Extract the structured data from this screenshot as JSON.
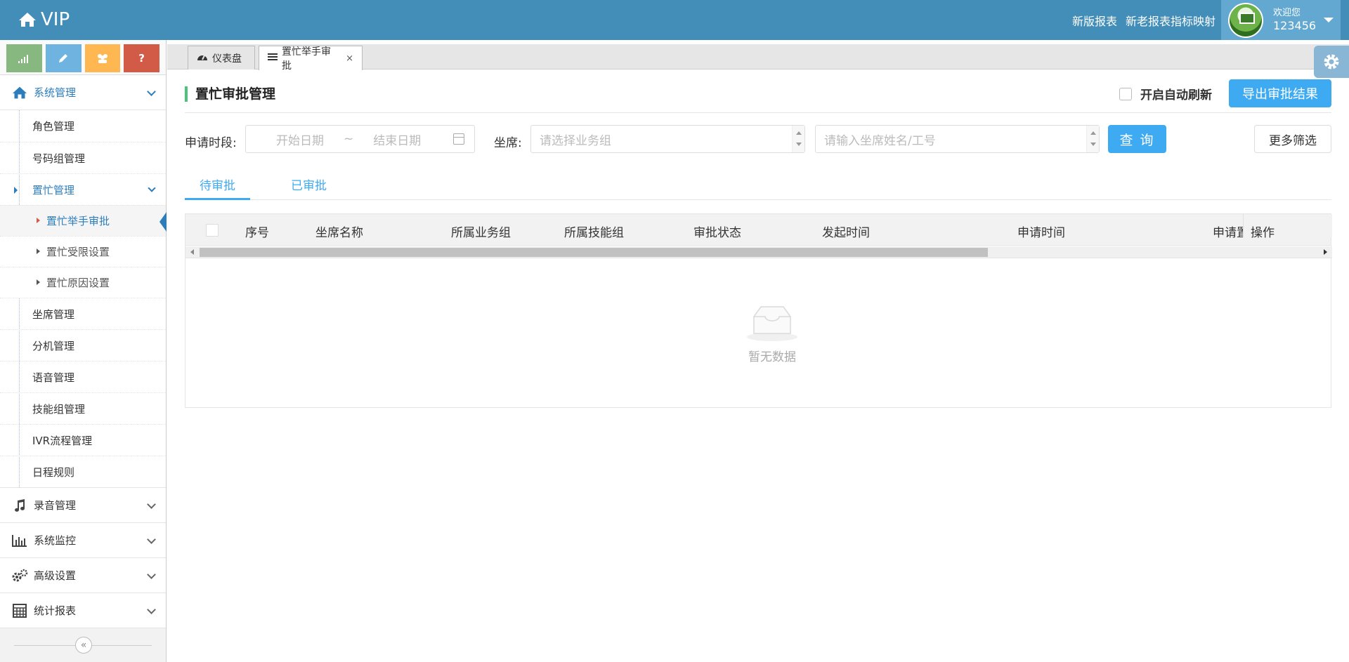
{
  "navbar": {
    "brand": "VIP",
    "links": [
      "新版报表",
      "新老报表指标映射"
    ],
    "welcome": "欢迎您",
    "username": "123456"
  },
  "sidebar": {
    "shortcuts": [
      {
        "icon": "signal-icon",
        "color": "#87b87f"
      },
      {
        "icon": "pencil-icon",
        "color": "#6fb3e0"
      },
      {
        "icon": "users-icon",
        "color": "#ffb752"
      },
      {
        "icon": "question-icon",
        "color": "#d15b47",
        "glyph": "?"
      }
    ],
    "system": {
      "label": "系统管理",
      "items": [
        "角色管理",
        "号码组管理"
      ],
      "busy": {
        "label": "置忙管理",
        "children": [
          "置忙举手审批",
          "置忙受限设置",
          "置忙原因设置"
        ]
      },
      "items_after": [
        "坐席管理",
        "分机管理",
        "语音管理",
        "技能组管理",
        "IVR流程管理",
        "日程规则"
      ]
    },
    "sections": [
      "录音管理",
      "系统监控",
      "高级设置",
      "统计报表"
    ],
    "collapse_glyph": "«"
  },
  "tabs": [
    {
      "label": "仪表盘",
      "icon": "dashboard-icon"
    },
    {
      "label": "置忙举手审批",
      "icon": "list-icon",
      "close": "×"
    }
  ],
  "page": {
    "title": "置忙审批管理",
    "auto_refresh": "开启自动刷新",
    "export": "导出审批结果"
  },
  "filter": {
    "period_label": "申请时段:",
    "start_placeholder": "开始日期",
    "sep": "~",
    "end_placeholder": "结束日期",
    "seat_label": "坐席:",
    "group_placeholder": "请选择业务组",
    "name_placeholder": "请输入坐席姓名/工号",
    "query": "查 询",
    "more": "更多筛选"
  },
  "subtabs": [
    "待审批",
    "已审批"
  ],
  "table": {
    "columns": [
      "序号",
      "坐席名称",
      "所属业务组",
      "所属技能组",
      "审批状态",
      "发起时间",
      "申请时间",
      "申请置"
    ],
    "op_column": "操作",
    "empty": "暂无数据"
  },
  "colors": {
    "navbar": "#438eb9",
    "accent": "#3eaaf2",
    "title_bar": "#4cc37a"
  }
}
